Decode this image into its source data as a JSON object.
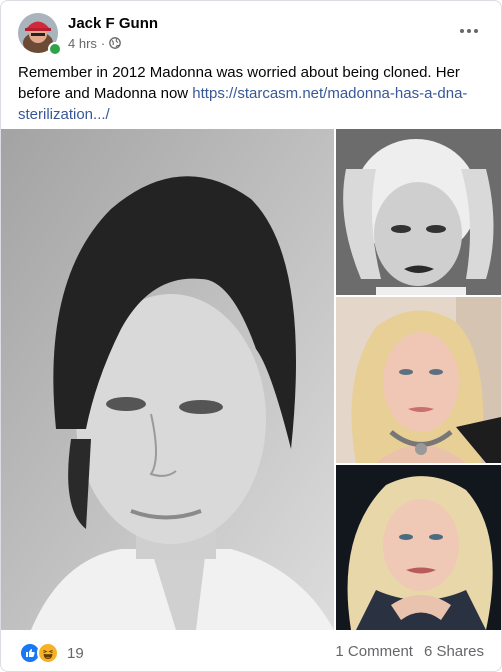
{
  "post": {
    "author": "Jack F Gunn",
    "time": "4 hrs",
    "separator": "·",
    "audience_icon": "globe-icon",
    "more_icon": "more-options-icon",
    "text": "Remember in 2012 Madonna was worried about being cloned. Her before and Madonna now ",
    "link_text": "https://starcasm.net/madonna-has-a-dna-sterilization.../",
    "link_url": "https://starcasm.net/madonna-has-a-dna-sterilization.../"
  },
  "footer": {
    "reactions": [
      "like-icon",
      "haha-icon"
    ],
    "reaction_count": "19",
    "comments": "1 Comment",
    "shares": "6 Shares"
  },
  "colors": {
    "link": "#385898",
    "secondary_text": "#65676b",
    "online": "#31a24c",
    "like": "#1877f2",
    "haha": "#f7b125"
  }
}
